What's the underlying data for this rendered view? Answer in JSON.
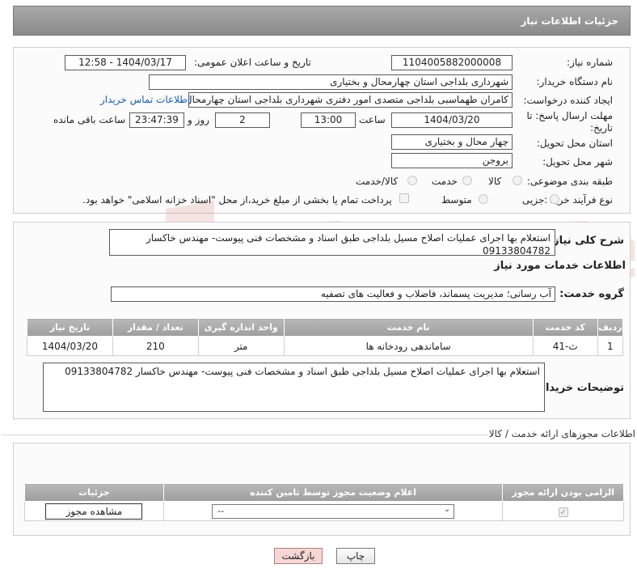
{
  "header": {
    "title": "جزئیات اطلاعات نیاز"
  },
  "form": {
    "need_number_label": "شماره نیاز:",
    "need_number": "1104005882000008",
    "announce_datetime_label": "تاریخ و ساعت اعلان عمومی:",
    "announce_datetime": "1404/03/17 - 12:58",
    "buyer_org_label": "نام دستگاه خریدار:",
    "buyer_org": "شهرداری بلداجی استان چهارمحال و بختیاری",
    "creator_label": "ایجاد کننده درخواست:",
    "creator": "کامران طهماسبی بلداجی متصدی امور دفتری شهرداری بلداجی استان چهارمحال و بختیاری",
    "buyer_contact_link": "اطلاعات تماس خریدار",
    "deadline_label": "مهلت ارسال پاسخ: تا تاریخ:",
    "deadline_date": "1404/03/20",
    "time_label": "ساعت",
    "deadline_time": "13:00",
    "days_value": "2",
    "days_label": "روز و",
    "remaining_time": "23:47:39",
    "remaining_label": "ساعت باقی مانده",
    "province_label": "استان محل تحویل:",
    "province": "چهار محال و بختیاری",
    "city_label": "شهر محل تحویل:",
    "city": "بروجن",
    "category_label": "طبقه بندی موضوعی:",
    "category_options": [
      "کالا",
      "خدمت",
      "کالا/خدمت"
    ],
    "process_label": "نوع فرآیند خرید :",
    "process_options": [
      "جزیی",
      "متوسط"
    ],
    "payment_note": "پرداخت تمام یا بخشی از مبلغ خرید،از محل \"اسناد خزانه اسلامی\" خواهد بود."
  },
  "summary": {
    "label": "شرح کلی نیاز:",
    "text": "استعلام بها اجرای عملیات اصلاح مسیل بلداجی طبق اسناد و مشخصات فنی پیوست- مهندس خاکسار 09133804782"
  },
  "services": {
    "section_title": "اطلاعات خدمات مورد نیاز",
    "group_label": "گروه خدمت:",
    "group_value": "آب رسانی؛ مدیریت پسماند، فاضلاب و فعالیت های تصفیه",
    "columns": [
      "ردیف",
      "کد خدمت",
      "نام خدمت",
      "واحد اندازه گیری",
      "تعداد / مقدار",
      "تاریخ نیاز"
    ],
    "rows": [
      [
        "1",
        "ث-41",
        "ساماندهی رودخانه ها",
        "متر",
        "210",
        "1404/03/20"
      ]
    ]
  },
  "buyer_notes": {
    "label": "توضیحات خریدار:",
    "text": "استعلام بها اجرای عملیات اصلاح مسیل بلداجی طبق اسناد و مشخصات فنی پیوست- مهندس خاکسار 09133804782"
  },
  "permits": {
    "section_title": "اطلاعات مجوزهای ارائه خدمت / کالا",
    "columns": [
      "الزامی بودن ارائه مجوز",
      "اعلام وضعیت مجوز توسط تامین کننده",
      "جزئیات"
    ],
    "select_value": "--",
    "view_button": "مشاهده مجوز"
  },
  "footer": {
    "print_button": "چاپ",
    "back_button": "بازگشت"
  },
  "watermark": {
    "text": "AriaTender.neT"
  },
  "colors": {
    "header_bg": "#999999",
    "link": "#1a5fb4",
    "back_button_bg": "#f7d6d6"
  }
}
